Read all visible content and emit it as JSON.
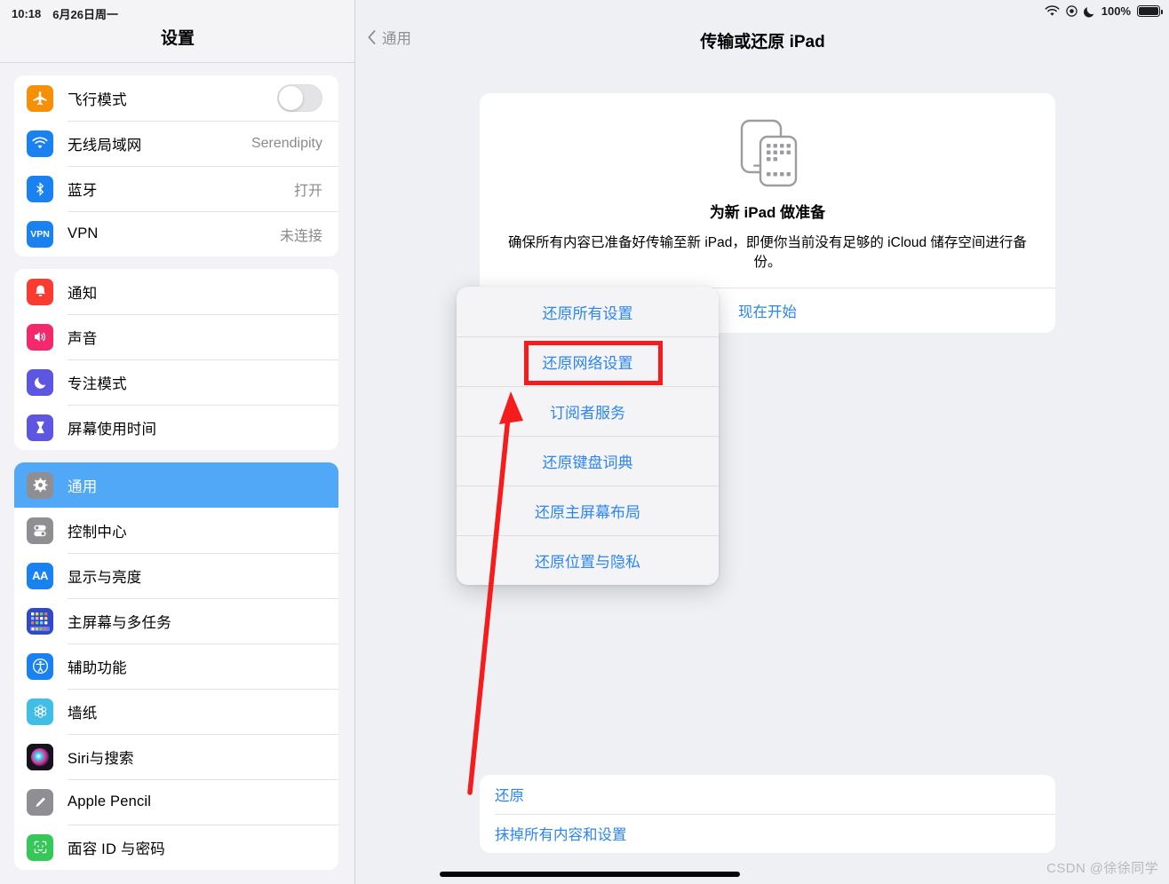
{
  "status_bar": {
    "time": "10:18",
    "date": "6月26日周一",
    "battery_percent": "100%",
    "icons": [
      "wifi-icon",
      "location-icon",
      "moon-focus-icon",
      "battery-icon"
    ]
  },
  "sidebar": {
    "title": "设置",
    "groups": [
      {
        "items": [
          {
            "label": "飞行模式",
            "icon": "airplane-icon",
            "control": "toggle",
            "toggle_on": false
          },
          {
            "label": "无线局域网",
            "icon": "wifi-icon",
            "value": "Serendipity"
          },
          {
            "label": "蓝牙",
            "icon": "bluetooth-icon",
            "value": "打开"
          },
          {
            "label": "VPN",
            "icon": "vpn-icon",
            "value": "未连接"
          }
        ]
      },
      {
        "items": [
          {
            "label": "通知",
            "icon": "bell-icon",
            "value": ""
          },
          {
            "label": "声音",
            "icon": "speaker-icon",
            "value": ""
          },
          {
            "label": "专注模式",
            "icon": "moon-icon",
            "value": ""
          },
          {
            "label": "屏幕使用时间",
            "icon": "hourglass-icon",
            "value": ""
          }
        ]
      },
      {
        "items": [
          {
            "label": "通用",
            "icon": "gear-icon",
            "value": "",
            "selected": true
          },
          {
            "label": "控制中心",
            "icon": "control-center-icon",
            "value": ""
          },
          {
            "label": "显示与亮度",
            "icon": "display-aa-icon",
            "value": ""
          },
          {
            "label": "主屏幕与多任务",
            "icon": "home-screen-icon",
            "value": ""
          },
          {
            "label": "辅助功能",
            "icon": "accessibility-icon",
            "value": ""
          },
          {
            "label": "墙纸",
            "icon": "wallpaper-icon",
            "value": ""
          },
          {
            "label": "Siri与搜索",
            "icon": "siri-icon",
            "value": ""
          },
          {
            "label": "Apple Pencil",
            "icon": "pencil-icon",
            "value": ""
          },
          {
            "label": "面容 ID 与密码",
            "icon": "face-id-icon",
            "value": ""
          }
        ]
      }
    ]
  },
  "detail": {
    "back_label": "通用",
    "title": "传输或还原 iPad",
    "prepare_card": {
      "icon": "two-devices-icon",
      "title": "为新 iPad 做准备",
      "description": "确保所有内容已准备好传输至新 iPad，即便你当前没有足够的 iCloud 储存空间进行备份。",
      "action_label": "现在开始"
    },
    "bottom_card": {
      "rows": [
        {
          "label": "还原"
        },
        {
          "label": "抹掉所有内容和设置"
        }
      ]
    }
  },
  "popup_menu": {
    "items": [
      {
        "label": "还原所有设置",
        "highlighted": false
      },
      {
        "label": "还原网络设置",
        "highlighted": true
      },
      {
        "label": "订阅者服务",
        "highlighted": false
      },
      {
        "label": "还原键盘词典",
        "highlighted": false
      },
      {
        "label": "还原主屏幕布局",
        "highlighted": false
      },
      {
        "label": "还原位置与隐私",
        "highlighted": false
      }
    ]
  },
  "annotation": {
    "highlight_color": "#f41c1c",
    "arrow": "red-arrow-pointing-to-reset-network-settings"
  },
  "watermark": "CSDN @徐徐同学",
  "colors": {
    "accent_blue": "#2b85f2",
    "selected_row": "#51a8f7",
    "page_bg": "#eff0f4",
    "card_bg": "#ffffff",
    "annotation_red": "#f41c1c"
  }
}
